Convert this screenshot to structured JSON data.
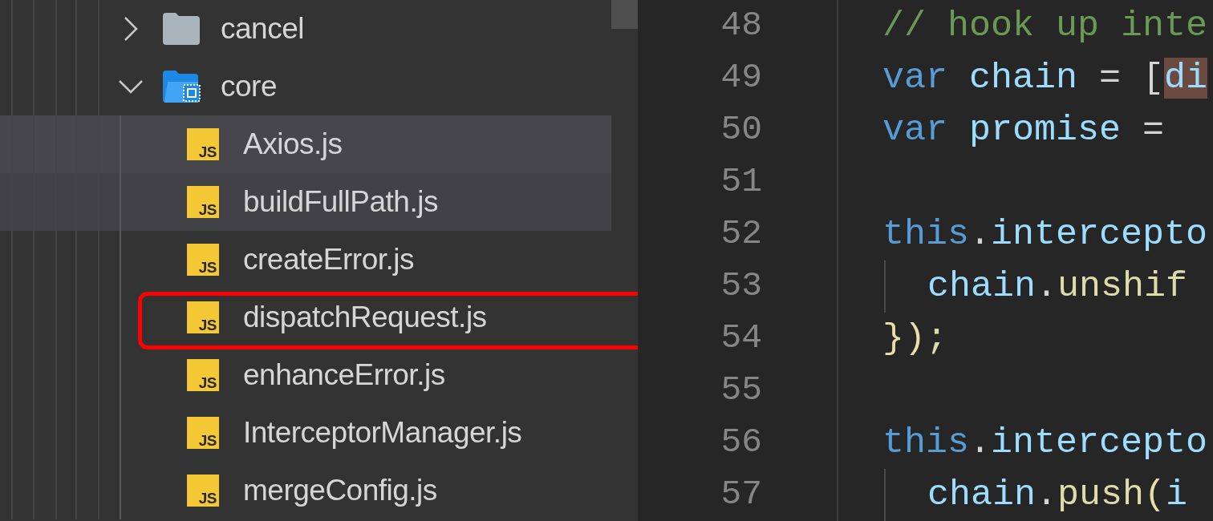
{
  "sidebar": {
    "tree": [
      {
        "name": "cancel",
        "kind": "folder",
        "expanded": false
      },
      {
        "name": "core",
        "kind": "folder",
        "expanded": true,
        "children": [
          {
            "name": "Axios.js",
            "kind": "file",
            "icon_text": "JS",
            "selected": true,
            "hovered": false,
            "highlighted": false
          },
          {
            "name": "buildFullPath.js",
            "kind": "file",
            "icon_text": "JS",
            "selected": false,
            "hovered": true,
            "highlighted": false
          },
          {
            "name": "createError.js",
            "kind": "file",
            "icon_text": "JS",
            "selected": false,
            "hovered": false,
            "highlighted": false
          },
          {
            "name": "dispatchRequest.js",
            "kind": "file",
            "icon_text": "JS",
            "selected": false,
            "hovered": false,
            "highlighted": true
          },
          {
            "name": "enhanceError.js",
            "kind": "file",
            "icon_text": "JS",
            "selected": false,
            "hovered": false,
            "highlighted": false
          },
          {
            "name": "InterceptorManager.js",
            "kind": "file",
            "icon_text": "JS",
            "selected": false,
            "hovered": false,
            "highlighted": false
          },
          {
            "name": "mergeConfig.js",
            "kind": "file",
            "icon_text": "JS",
            "selected": false,
            "hovered": false,
            "highlighted": false
          }
        ]
      }
    ]
  },
  "editor": {
    "lines": [
      {
        "number": "48",
        "indented": false,
        "tokens": [
          {
            "text": "// hook up inte",
            "kind": "comment"
          }
        ]
      },
      {
        "number": "49",
        "indented": false,
        "tokens": [
          {
            "text": "var",
            "kind": "keyword"
          },
          {
            "text": " chain",
            "kind": "variable"
          },
          {
            "text": " = [",
            "kind": "punct"
          },
          {
            "text": "di",
            "kind": "variable",
            "match": true
          }
        ]
      },
      {
        "number": "50",
        "indented": false,
        "tokens": [
          {
            "text": "var",
            "kind": "keyword"
          },
          {
            "text": " promise",
            "kind": "variable"
          },
          {
            "text": " =",
            "kind": "punct"
          }
        ]
      },
      {
        "number": "51",
        "indented": false
      },
      {
        "number": "52",
        "indented": false,
        "tokens": [
          {
            "text": "this",
            "kind": "keyword"
          },
          {
            "text": ".",
            "kind": "punct"
          },
          {
            "text": "intercepto",
            "kind": "variable"
          }
        ]
      },
      {
        "number": "53",
        "indented": true,
        "tokens": [
          {
            "text": "chain",
            "kind": "variable"
          },
          {
            "text": ".",
            "kind": "punct"
          },
          {
            "text": "unshif",
            "kind": "function"
          }
        ]
      },
      {
        "number": "54",
        "indented": false,
        "tokens": [
          {
            "text": "})",
            "kind": "bracket"
          },
          {
            "text": ";",
            "kind": "function"
          }
        ]
      },
      {
        "number": "55",
        "indented": false
      },
      {
        "number": "56",
        "indented": false,
        "tokens": [
          {
            "text": "this",
            "kind": "keyword"
          },
          {
            "text": ".",
            "kind": "punct"
          },
          {
            "text": "intercepto",
            "kind": "variable"
          }
        ]
      },
      {
        "number": "57",
        "indented": true,
        "tokens": [
          {
            "text": "chain",
            "kind": "variable"
          },
          {
            "text": ".",
            "kind": "punct"
          },
          {
            "text": "push",
            "kind": "function"
          },
          {
            "text": "(",
            "kind": "bracket"
          },
          {
            "text": "i",
            "kind": "variable"
          }
        ]
      }
    ]
  }
}
